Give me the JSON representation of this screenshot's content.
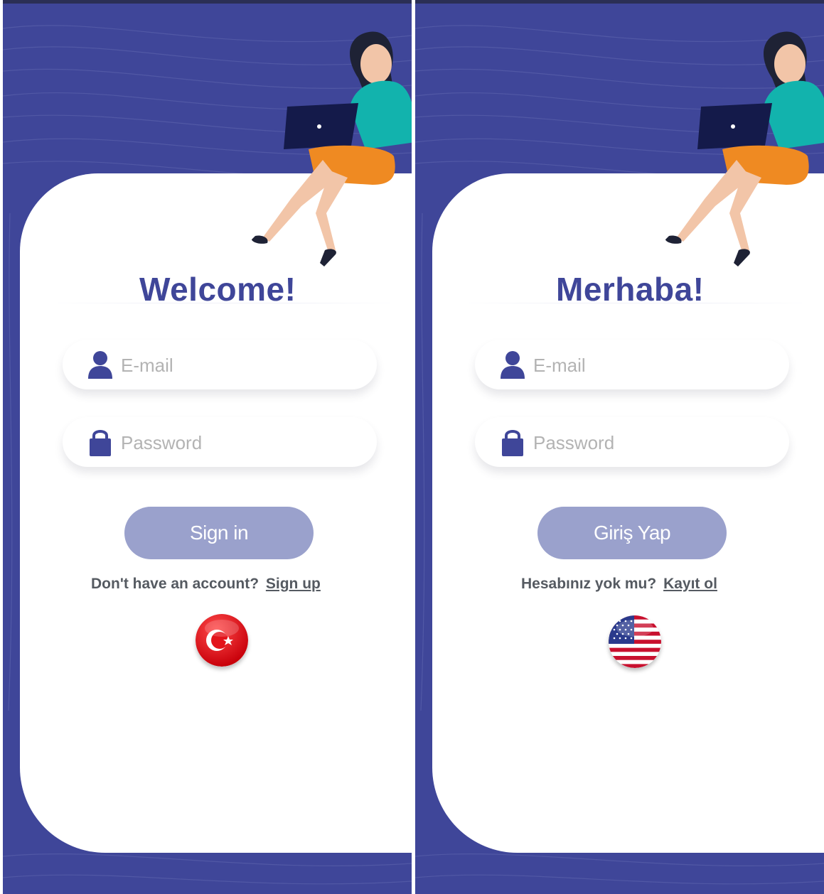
{
  "screens": [
    {
      "language": "en",
      "title": "Welcome!",
      "email_placeholder": "E-mail",
      "password_placeholder": "Password",
      "signin_label": "Sign in",
      "signup_prompt": "Don't have an account?",
      "signup_link": "Sign up",
      "flag_icon": "turkey-flag-icon"
    },
    {
      "language": "tr",
      "title": "Merhaba!",
      "email_placeholder": "E-mail",
      "password_placeholder": "Password",
      "signin_label": "Giriş Yap",
      "signup_prompt": "Hesabınız yok mu?",
      "signup_link": "Kayıt ol",
      "flag_icon": "usa-flag-icon"
    }
  ],
  "colors": {
    "background": "#3f4699",
    "accent": "#3f4699",
    "button": "#9aa1cc",
    "card": "#ffffff",
    "text_muted": "#555a61"
  }
}
